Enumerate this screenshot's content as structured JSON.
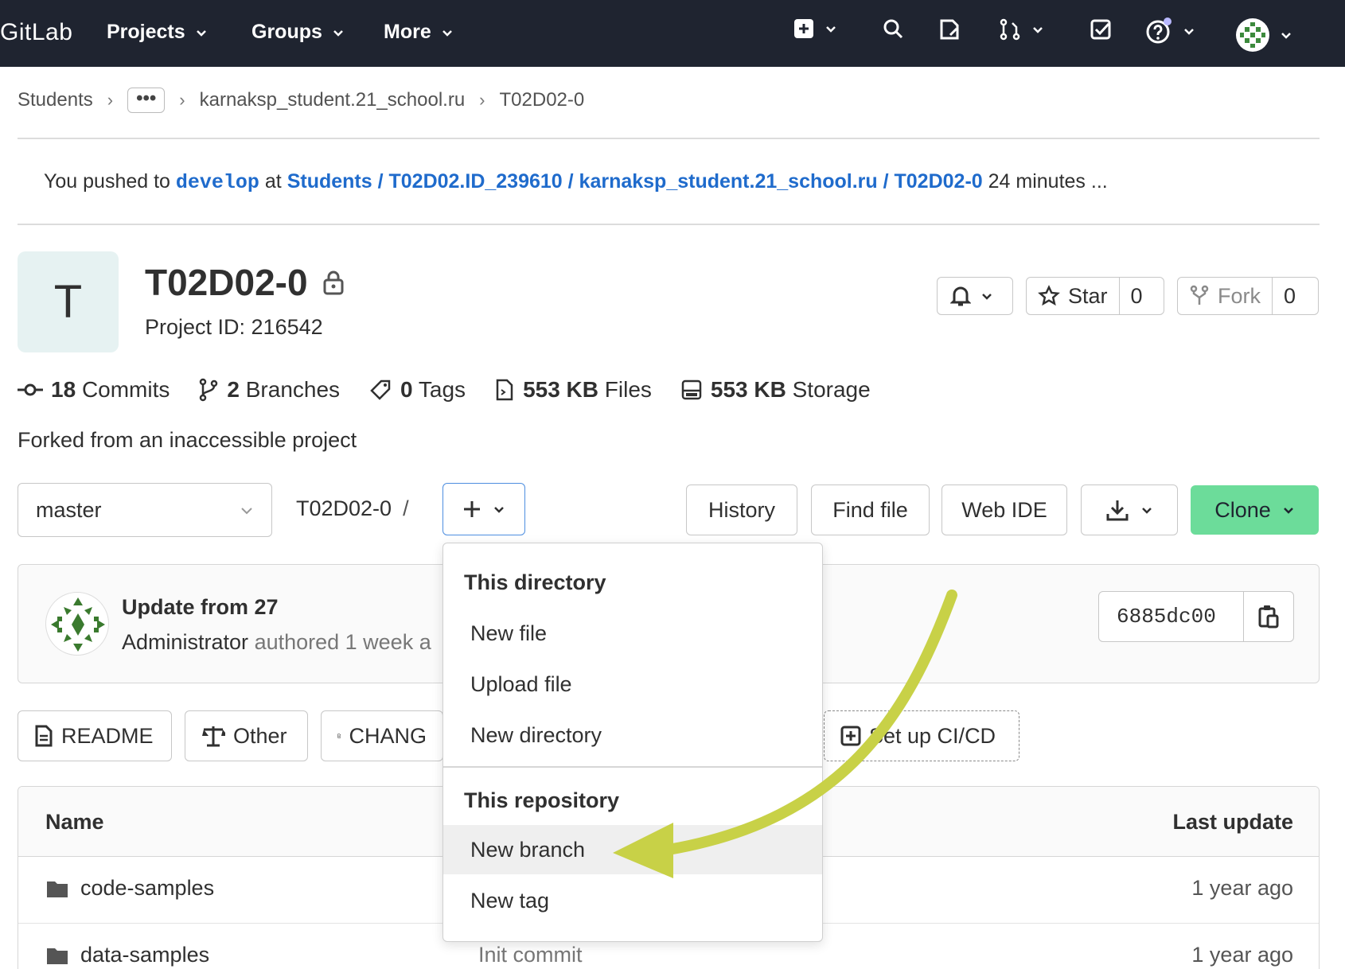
{
  "navbar": {
    "logo": "GitLab",
    "items": [
      {
        "label": "Projects"
      },
      {
        "label": "Groups"
      },
      {
        "label": "More"
      }
    ],
    "icons": [
      "plus-square-icon",
      "search-icon",
      "issues-icon",
      "merge-request-icon",
      "todo-icon",
      "help-icon",
      "user-avatar"
    ]
  },
  "breadcrumb": {
    "items": [
      "Students",
      "karnaksp_student.21_school.ru",
      "T02D02-0"
    ],
    "more": "•••"
  },
  "push_banner": {
    "prefix": "You pushed to",
    "branch": "develop",
    "at": "at",
    "path": "Students / T02D02.ID_239610 / karnaksp_student.21_school.ru / T02D02-0",
    "time": "24 minutes ..."
  },
  "project": {
    "avatar_letter": "T",
    "title": "T02D02-0",
    "id_label": "Project ID: 216542",
    "star_label": "Star",
    "star_count": "0",
    "fork_label": "Fork",
    "fork_count": "0"
  },
  "stats": {
    "commits_count": "18",
    "commits_label": "Commits",
    "branches_count": "2",
    "branches_label": "Branches",
    "tags_count": "0",
    "tags_label": "Tags",
    "files_size": "553 KB",
    "files_label": "Files",
    "storage_size": "553 KB",
    "storage_label": "Storage"
  },
  "forked_text": "Forked from an inaccessible project",
  "toolbar": {
    "branch": "master",
    "path": "T02D02-0",
    "path_sep": "/",
    "history": "History",
    "find_file": "Find file",
    "web_ide": "Web IDE",
    "clone": "Clone"
  },
  "commit": {
    "title": "Update from 27",
    "author": "Administrator",
    "meta": "authored 1 week a",
    "sha": "6885dc00"
  },
  "quick_buttons": {
    "readme": "README",
    "other": "Other",
    "changelog": "CHANG",
    "ci": "Set up CI/CD"
  },
  "table": {
    "headers": {
      "name": "Name",
      "last_update": "Last update"
    },
    "rows": [
      {
        "name": "code-samples",
        "message": "",
        "when": "1 year ago"
      },
      {
        "name": "data-samples",
        "message": "Init commit",
        "when": "1 year ago"
      }
    ]
  },
  "dropdown": {
    "section1": "This directory",
    "items1": [
      "New file",
      "Upload file",
      "New directory"
    ],
    "section2": "This repository",
    "items2": [
      "New branch",
      "New tag"
    ]
  },
  "colors": {
    "navbar": "#1f2430",
    "link": "#1f6bcc",
    "clone_button": "#6cdc9a",
    "annotation_arrow": "#c8d147"
  }
}
